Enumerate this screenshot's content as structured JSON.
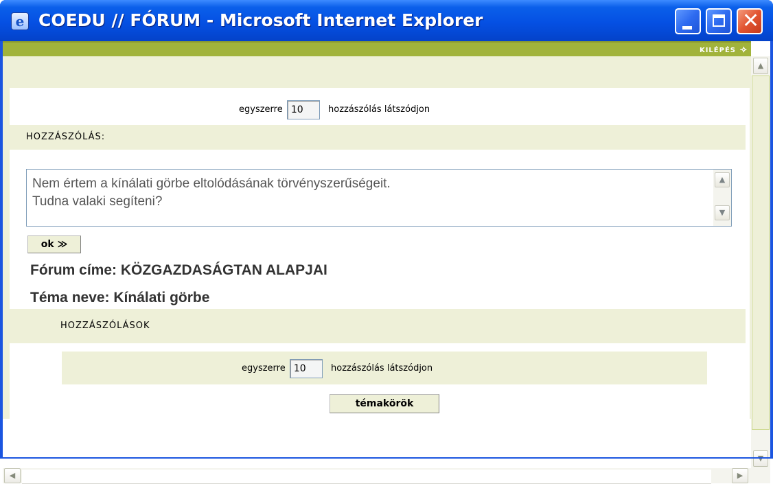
{
  "window": {
    "title": "COEDU // FÓRUM - Microsoft Internet Explorer",
    "icon": "internet-explorer-icon",
    "min_glyph": "minimize-icon",
    "max_glyph": "maximize-icon",
    "close_glyph": "✕"
  },
  "header": {
    "logout_label": "KILÉPÉS",
    "logout_icon": "⟢"
  },
  "top_control": {
    "prefix": "egyszerre",
    "value": "10",
    "suffix": "hozzászólás látszódjon"
  },
  "comment_section": {
    "title": "HOZZÁSZÓLÁS:",
    "text": "Nem értem a kínálati görbe eltolódásának törvényszerűségeit.\nTudna valaki segíteni?",
    "submit_label": "ok ≫"
  },
  "forum": {
    "forum_title": "Fórum címe: KÖZGAZDASÁGTAN ALAPJAI",
    "topic_name": "Téma neve: Kínálati görbe"
  },
  "comments_section": {
    "title": "HOZZÁSZÓLÁSOK"
  },
  "bottom_control": {
    "prefix": "egyszerre",
    "value": "10",
    "suffix": "hozzászólás látszódjon"
  },
  "topics_button_label": "témakörök",
  "scrollbars": {
    "up": "▲",
    "down": "▼",
    "left": "◀",
    "right": "▶"
  },
  "colors": {
    "accent_band": "#a1b33b",
    "section_bg": "#eef0d8",
    "titlebar_blue": "#0550e3"
  }
}
